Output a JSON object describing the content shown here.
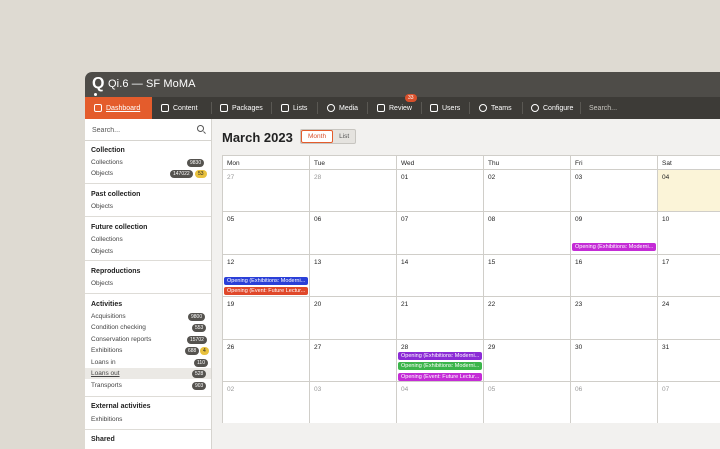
{
  "app": {
    "logo": "Q",
    "title": "Qi.6 — SF MoMA"
  },
  "nav": {
    "items": [
      {
        "label": "Dashboard",
        "icon": "dashboard-icon"
      },
      {
        "label": "Content",
        "icon": "content-icon"
      },
      {
        "label": "Packages",
        "icon": "packages-icon"
      },
      {
        "label": "Lists",
        "icon": "lists-icon"
      },
      {
        "label": "Media",
        "icon": "media-icon"
      },
      {
        "label": "Review",
        "icon": "review-icon",
        "badge": "33"
      },
      {
        "label": "Users",
        "icon": "users-icon"
      },
      {
        "label": "Teams",
        "icon": "globe-icon"
      },
      {
        "label": "Configure",
        "icon": "configure-icon"
      }
    ],
    "search_placeholder": "Search..."
  },
  "sidebar": {
    "search_placeholder": "Search...",
    "sections": [
      {
        "title": "Collection",
        "items": [
          {
            "label": "Collections",
            "count": "9830"
          },
          {
            "label": "Objects",
            "count": "147022",
            "count2": "53"
          }
        ]
      },
      {
        "title": "Past collection",
        "items": [
          {
            "label": "Objects"
          }
        ]
      },
      {
        "title": "Future collection",
        "items": [
          {
            "label": "Collections"
          },
          {
            "label": "Objects"
          }
        ]
      },
      {
        "title": "Reproductions",
        "items": [
          {
            "label": "Objects"
          }
        ]
      },
      {
        "title": "Activities",
        "items": [
          {
            "label": "Acquisitions",
            "count": "9800"
          },
          {
            "label": "Condition checking",
            "count": "553"
          },
          {
            "label": "Conservation reports",
            "count": "15702"
          },
          {
            "label": "Exhibitions",
            "count": "688",
            "count2": "4"
          },
          {
            "label": "Loans in",
            "count": "110"
          },
          {
            "label": "Loans out",
            "count": "528"
          },
          {
            "label": "Transports",
            "count": "903"
          }
        ]
      },
      {
        "title": "External activities",
        "items": [
          {
            "label": "Exhibitions"
          }
        ]
      },
      {
        "title": "Shared",
        "items": []
      }
    ]
  },
  "calendar": {
    "title": "March 2023",
    "views": [
      "Month",
      "List"
    ],
    "active_view": "Month",
    "weekdays": [
      "Mon",
      "Tue",
      "Wed",
      "Thu",
      "Fri",
      "Sat"
    ],
    "weeks": [
      [
        "27",
        "28",
        "01",
        "02",
        "03",
        "04"
      ],
      [
        "05",
        "06",
        "07",
        "08",
        "09",
        "10"
      ],
      [
        "12",
        "13",
        "14",
        "15",
        "16",
        "17"
      ],
      [
        "19",
        "20",
        "21",
        "22",
        "23",
        "24"
      ],
      [
        "26",
        "27",
        "28",
        "29",
        "30",
        "31"
      ],
      [
        "02",
        "03",
        "04",
        "05",
        "06",
        "07"
      ]
    ],
    "today": "04",
    "events": [
      {
        "week": 1,
        "day": 4,
        "label": "Opening (Exhibitions: Moderni...",
        "color": "#c42bd6"
      },
      {
        "week": 2,
        "day": 0,
        "label": "Opening (Exhibitions: Moderni...",
        "color": "#2a3fd8"
      },
      {
        "week": 2,
        "day": 0,
        "label": "Opening (Event: Future Lectur...",
        "color": "#e0482a"
      },
      {
        "week": 4,
        "day": 2,
        "label": "Opening (Exhibitions: Moderni...",
        "color": "#8b2bd6"
      },
      {
        "week": 4,
        "day": 2,
        "label": "Opening (Exhibitions: Moderni...",
        "color": "#3bb54a"
      },
      {
        "week": 4,
        "day": 2,
        "label": "Opening (Event: Future Lectur...",
        "color": "#c42bd6"
      }
    ]
  }
}
